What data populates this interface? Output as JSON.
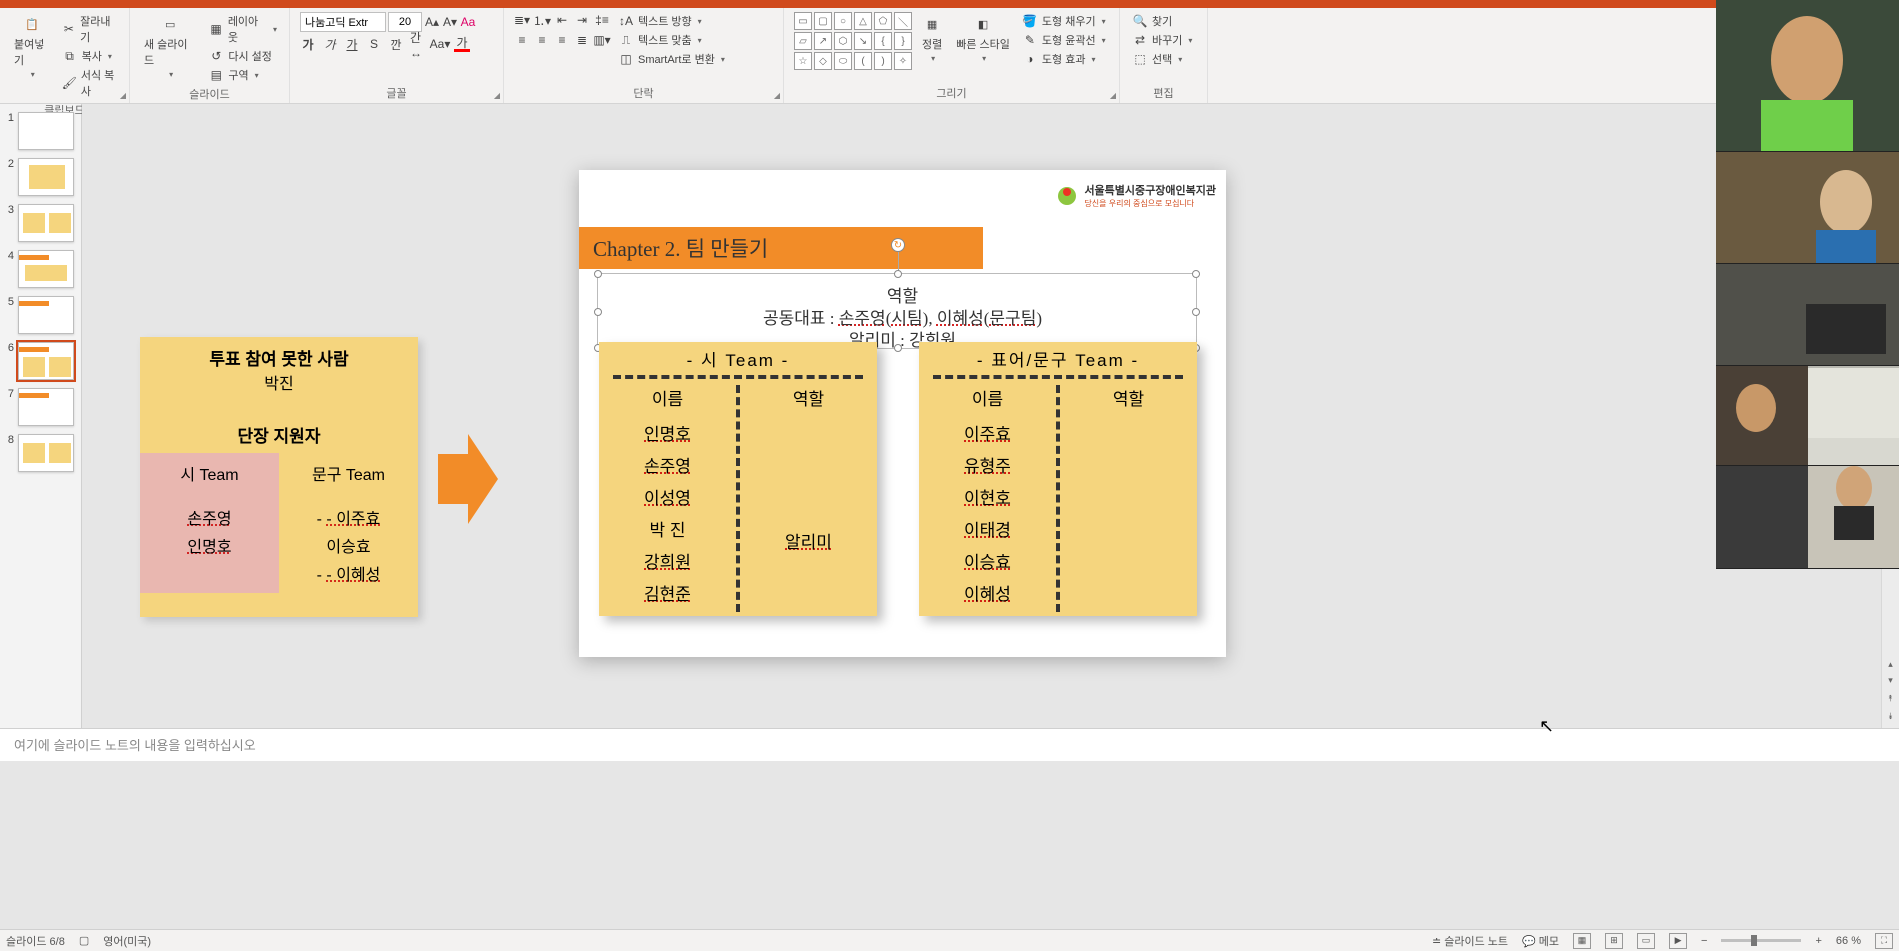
{
  "ribbon": {
    "clipboard": {
      "paste": "붙여넣기",
      "cut": "잘라내기",
      "copy": "복사",
      "format_painter": "서식 복사",
      "group_label": "클립보드"
    },
    "slides": {
      "new_slide": "새 슬라이드",
      "layout": "레이아웃",
      "reset": "다시 설정",
      "section": "구역",
      "group_label": "슬라이드"
    },
    "font": {
      "name": "나눔고딕 Extr",
      "size": "20",
      "group_label": "글꼴"
    },
    "paragraph": {
      "text_direction": "텍스트 방향",
      "text_align": "텍스트 맞춤",
      "smartart": "SmartArt로 변환",
      "group_label": "단락"
    },
    "drawing": {
      "arrange": "정렬",
      "quick_styles": "빠른 스타일",
      "shape_fill": "도형 채우기",
      "shape_outline": "도형 윤곽선",
      "shape_effects": "도형 효과",
      "group_label": "그리기"
    },
    "editing": {
      "find": "찾기",
      "replace": "바꾸기",
      "select": "선택",
      "group_label": "편집"
    }
  },
  "thumbnails": [
    {
      "num": "1"
    },
    {
      "num": "2"
    },
    {
      "num": "3"
    },
    {
      "num": "4"
    },
    {
      "num": "5"
    },
    {
      "num": "6"
    },
    {
      "num": "7"
    },
    {
      "num": "8"
    }
  ],
  "selected_slide": 6,
  "notebox": {
    "title": "투표 참여  못한 사람",
    "name": "박진",
    "sub_title": "단장 지원자",
    "col1_h": "시 Team",
    "col2_h": "문구 Team",
    "col1": [
      "손주영",
      "인명호"
    ],
    "col2": [
      "- 이주효",
      "이승효",
      "- 이혜성"
    ]
  },
  "slide": {
    "logo_text1": "서울특별시중구장애인복지관",
    "logo_text2": "당신을 우리의 중심으로 모십니다",
    "chapter": "Chapter 2. 팀 만들기",
    "role_label": "역할",
    "role_line": "공동대표 : 손주영(시팀), 이혜성(문구팀)",
    "role_line2": "알리미 : 강희원",
    "team_si": {
      "header": "-   시 Team   -",
      "col_name": "이름",
      "col_role": "역할",
      "names": [
        "인명호",
        "손주영",
        "이성영",
        "박   진",
        "강희원",
        "김현준"
      ],
      "role_values": [
        "",
        "",
        "",
        "",
        "알리미",
        ""
      ]
    },
    "team_mg": {
      "header": "-   표어/문구 Team   -",
      "col_name": "이름",
      "col_role": "역할",
      "names": [
        "이주효",
        "유형주",
        "이현호",
        "이태경",
        "이승효",
        "이혜성"
      ]
    }
  },
  "notes_placeholder": "여기에 슬라이드 노트의 내용을 입력하십시오",
  "status": {
    "slide_info": "슬라이드 6/8",
    "language": "영어(미국)",
    "notes_btn": "슬라이드 노트",
    "comments_btn": "메모",
    "zoom": "66 %"
  }
}
